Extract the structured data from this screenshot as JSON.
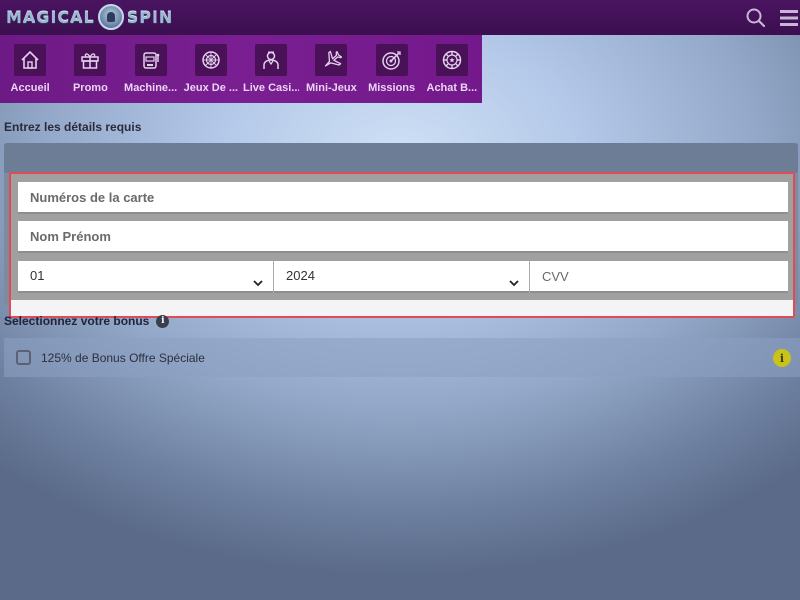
{
  "header": {
    "logo_left": "MAGICAL",
    "logo_right": "SPIN"
  },
  "categories": [
    {
      "label": "Accueil",
      "icon": "home-icon"
    },
    {
      "label": "Promo",
      "icon": "gift-icon"
    },
    {
      "label": "Machine...",
      "icon": "slot-machine-icon"
    },
    {
      "label": "Jeux De ...",
      "icon": "roulette-icon"
    },
    {
      "label": "Live Casi...",
      "icon": "dealer-icon"
    },
    {
      "label": "Mini-Jeux",
      "icon": "airplane-icon"
    },
    {
      "label": "Missions",
      "icon": "target-icon"
    },
    {
      "label": "Achat B...",
      "icon": "chip-icon"
    }
  ],
  "form": {
    "section_title": "Entrez les détails requis",
    "card_number_placeholder": "Numéros de la carte",
    "name_placeholder": "Nom Prénom",
    "month_value": "01",
    "year_value": "2024",
    "cvv_placeholder": "CVV"
  },
  "bonus": {
    "title": "Selectionnez votre bonus",
    "info_glyph": "i",
    "option_label": "125% de Bonus Offre Spéciale"
  },
  "colors": {
    "header_bg": "#3b0f50",
    "nav_bg": "#7a1f92",
    "highlight_border": "#e04b55",
    "info_yellow": "#c8c21a"
  }
}
